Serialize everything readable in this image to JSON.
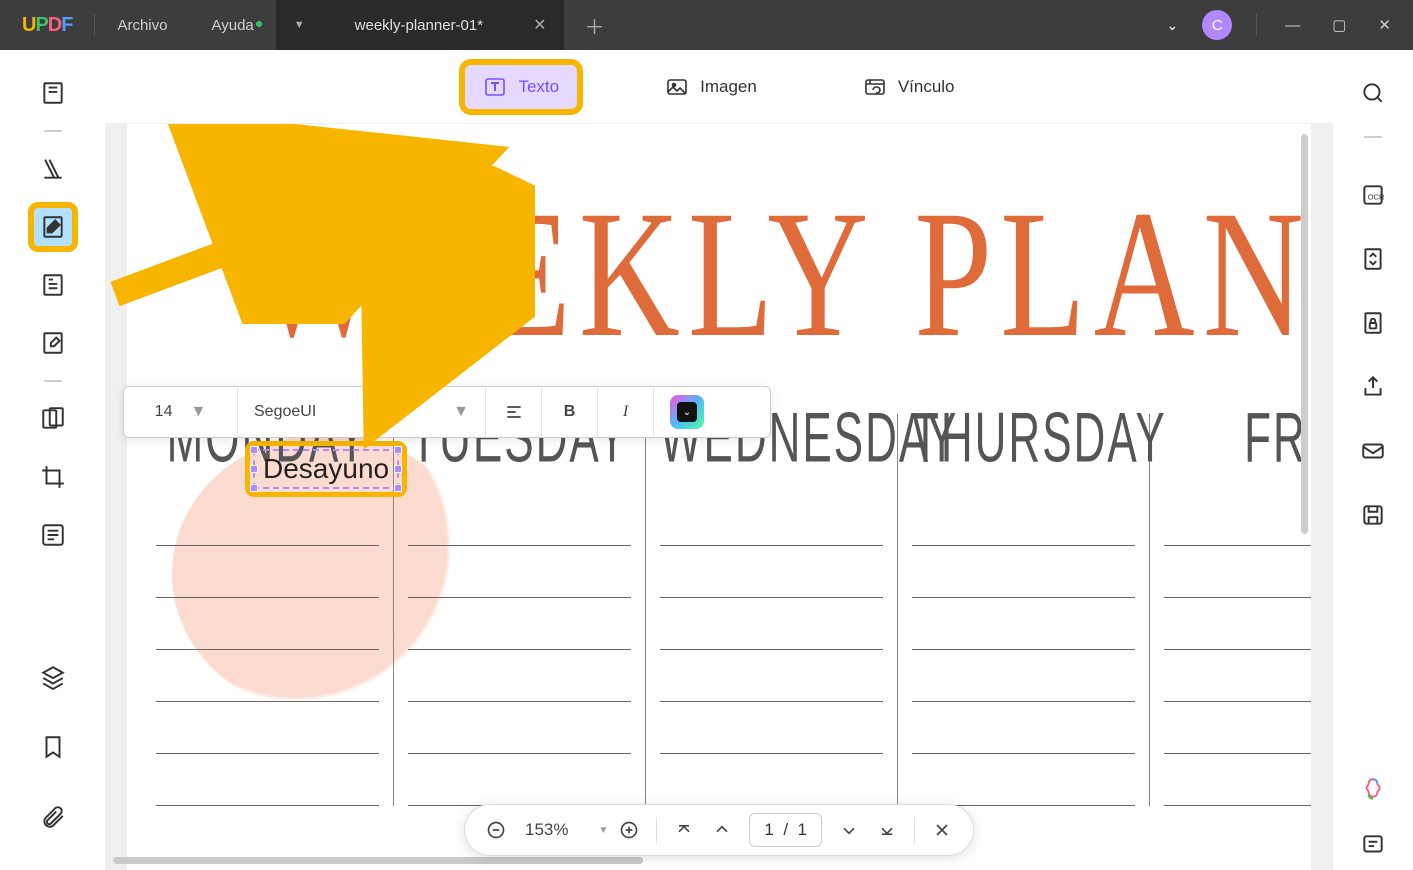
{
  "titlebar": {
    "menu": {
      "file": "Archivo",
      "help": "Ayuda"
    },
    "tab_title": "weekly-planner-01*",
    "avatar_letter": "C"
  },
  "toolbar": {
    "text_label": "Texto",
    "image_label": "Imagen",
    "link_label": "Vínculo"
  },
  "format_bar": {
    "font_size": "14",
    "font_family": "SegoeUI",
    "bold": "B",
    "italic": "I"
  },
  "document": {
    "title": "WEEKLY PLANN",
    "inserted_text": "Desayuno",
    "days": [
      "MONDAY",
      "TUESDAY",
      "WEDNESDAY",
      "THURSDAY",
      "FR"
    ]
  },
  "page_bar": {
    "zoom": "153%",
    "page_current": "1",
    "page_total": "1"
  }
}
